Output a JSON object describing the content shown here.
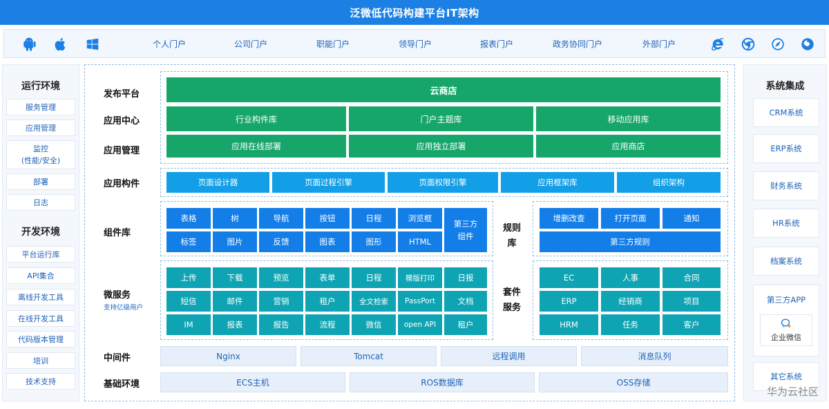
{
  "title": "泛微低代码构建平台IT架构",
  "platform_icons": [
    {
      "icon": "android-icon",
      "color": "#1b7fe3"
    },
    {
      "icon": "apple-icon",
      "color": "#1b7fe3"
    },
    {
      "icon": "windows-icon",
      "color": "#1b7fe3"
    }
  ],
  "browser_icons": [
    {
      "icon": "ie-icon",
      "color": "#1b7fe3"
    },
    {
      "icon": "chrome-icon",
      "color": "#1b7fe3"
    },
    {
      "icon": "safari-icon",
      "color": "#1b7fe3"
    },
    {
      "icon": "firefox-icon",
      "color": "#1b7fe3"
    }
  ],
  "portals": [
    "个人门户",
    "公司门户",
    "职能门户",
    "领导门户",
    "报表门户",
    "政务协同门户",
    "外部门户"
  ],
  "left_panel": {
    "runtime_title": "运行环境",
    "runtime_items": [
      "服务管理",
      "应用管理",
      "监控",
      "(性能/安全)",
      "部署",
      "日志"
    ],
    "dev_title": "开发环境",
    "dev_items": [
      "平台运行库",
      "API集合",
      "离线开发工具",
      "在线开发工具",
      "代码版本管理",
      "培训",
      "技术支持"
    ]
  },
  "right_panel": {
    "title": "系统集成",
    "items": [
      "CRM系统",
      "ERP系统",
      "财务系统",
      "HR系统",
      "档案系统",
      "第三方APP",
      "企业微信",
      "其它系统"
    ]
  },
  "row_labels": {
    "publish": "发布平台",
    "app_center": "应用中心",
    "app_manage": "应用管理",
    "app_component": "应用构件",
    "component_lib": "组件库",
    "microservice": "微服务",
    "microservice_sub": "支持亿级用户",
    "middleware": "中间件",
    "infra": "基础环境"
  },
  "publish": {
    "cloud_store": "云商店"
  },
  "app_center": [
    "行业构件库",
    "门户主题库",
    "移动应用库"
  ],
  "app_manage": [
    "应用在线部署",
    "应用独立部署",
    "应用商店"
  ],
  "app_component": [
    "页面设计器",
    "页面过程引擎",
    "页面权限引擎",
    "应用框架库",
    "组织架构"
  ],
  "component_lib": {
    "row1": [
      "表格",
      "树",
      "导航",
      "按钮",
      "日程",
      "浏览框"
    ],
    "row2": [
      "标签",
      "图片",
      "反馈",
      "图表",
      "图形",
      "HTML"
    ],
    "third_party": [
      "第三方",
      "组件"
    ]
  },
  "rule_lib": {
    "label": [
      "规则",
      "库"
    ],
    "row1": [
      "增删改查",
      "打开页面",
      "通知"
    ],
    "row2": "第三方规则"
  },
  "microservice": {
    "row1": [
      "上传",
      "下载",
      "预览",
      "表单",
      "日程",
      "模版打印",
      "日报"
    ],
    "row2": [
      "短信",
      "邮件",
      "营销",
      "租户",
      "全文检索",
      "PassPort",
      "文档"
    ],
    "row3": [
      "IM",
      "报表",
      "报告",
      "流程",
      "微信",
      "open API",
      "租户"
    ]
  },
  "suite": {
    "label": [
      "套件",
      "服务"
    ],
    "row1": [
      "EC",
      "人事",
      "合同"
    ],
    "row2": [
      "ERP",
      "经销商",
      "项目"
    ],
    "row3": [
      "HRM",
      "任务",
      "客户"
    ]
  },
  "middleware": [
    "Nginx",
    "Tomcat",
    "远程调用",
    "消息队列"
  ],
  "infra": [
    "ECS主机",
    "ROS数据库",
    "OSS存储"
  ],
  "watermark": "华为云社区",
  "colors": {
    "title_bar": "#1b7fe3",
    "green": "#16a66a",
    "light_blue": "#129fe7",
    "deep_blue": "#137ee8",
    "teal": "#0fa4b4",
    "pale": "#e7f0fa"
  }
}
